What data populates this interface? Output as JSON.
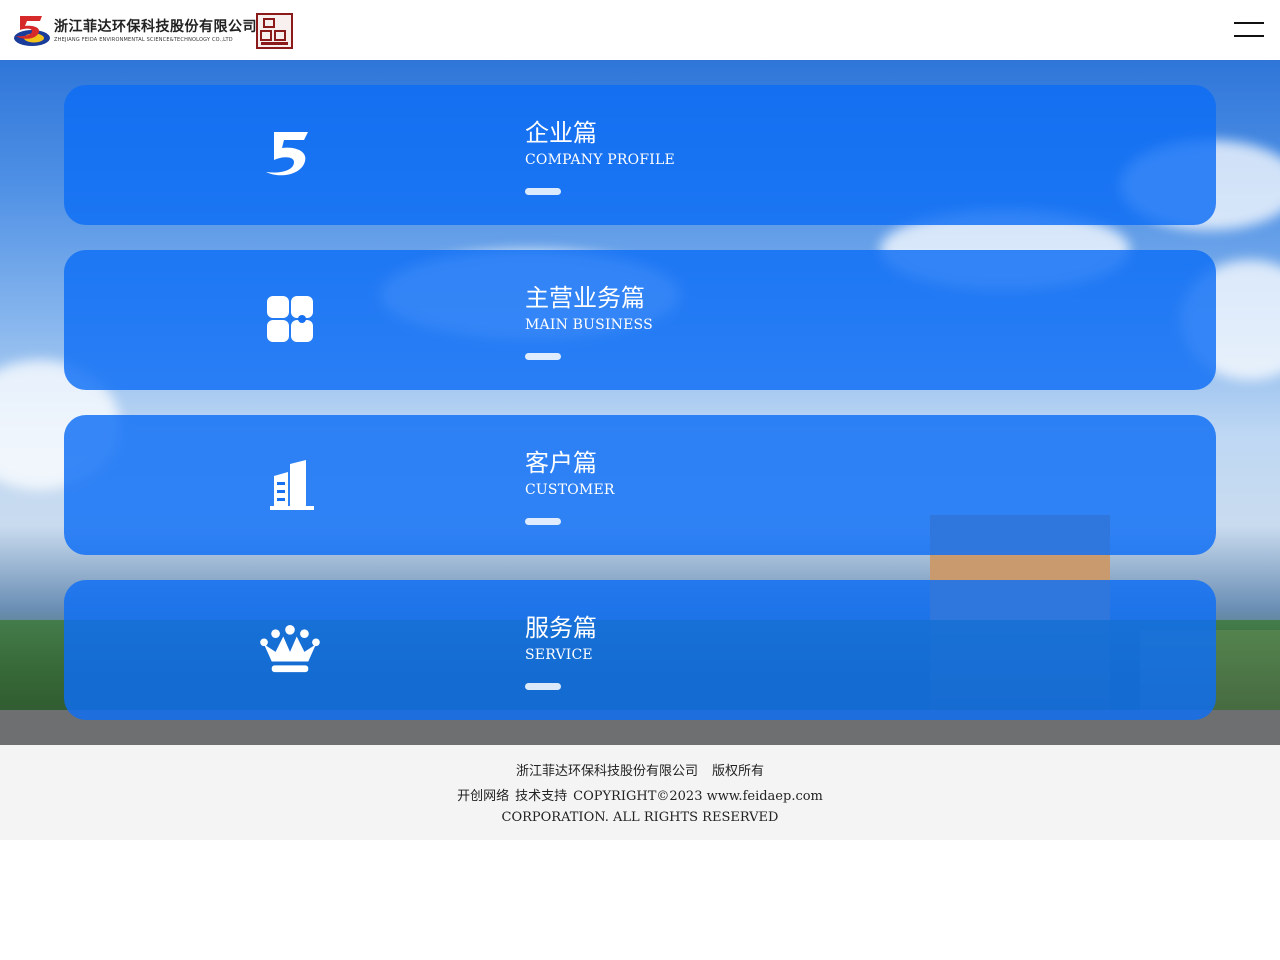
{
  "header": {
    "logo_cn": "浙江菲达环保科技股份有限公司",
    "logo_en": "ZHEJIANG FEIDA ENVIRONMENTAL SCIENCE&TECHNOLOGY CO.,LTD"
  },
  "cards": [
    {
      "title": "企业篇",
      "subtitle": "COMPANY PROFILE",
      "icon": "company-logo-icon"
    },
    {
      "title": "主营业务篇",
      "subtitle": "MAIN BUSINESS",
      "icon": "grid-apps-icon"
    },
    {
      "title": "客户篇",
      "subtitle": "CUSTOMER",
      "icon": "building-icon"
    },
    {
      "title": "服务篇",
      "subtitle": "SERVICE",
      "icon": "crown-icon"
    }
  ],
  "footer": {
    "company": "浙江菲达环保科技股份有限公司",
    "rights_cn": "版权所有",
    "developer": "开创网络",
    "support": "技术支持",
    "copyright": "COPYRIGHT©2023 www.feidaep.com",
    "reserved": "CORPORATION. ALL RIGHTS RESERVED"
  },
  "colors": {
    "card_blue": "#0e6ef5",
    "header_bg": "#ffffff",
    "footer_bg": "#f4f4f4"
  }
}
